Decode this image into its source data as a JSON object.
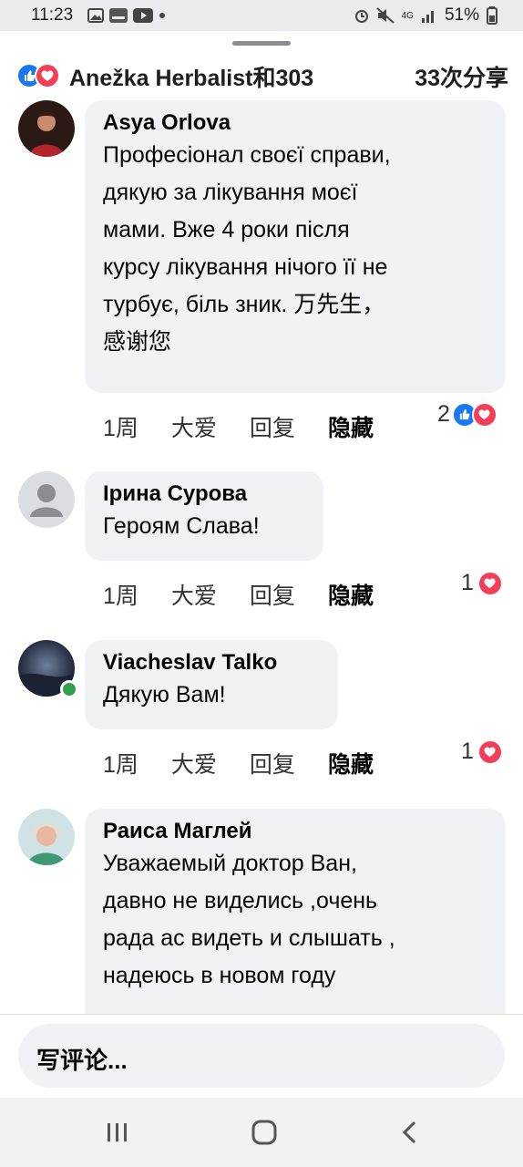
{
  "status_bar": {
    "time": "11:23",
    "signal_label": "4G",
    "battery": "51%"
  },
  "header": {
    "reactors": "Anežka Herbalist和303",
    "shares": "33次分享"
  },
  "comments": [
    {
      "author": "Asya Orlova",
      "lines": [
        "Професіонал своєї справи,",
        "дякую за лікування моєї",
        "мами. Вже 4 роки після",
        "курсу лікування нічого її не",
        "турбує, біль зник. 万先生，",
        "感谢您"
      ],
      "time": "1周",
      "love": "大爱",
      "reply": "回复",
      "hide": "隐藏",
      "reaction_count": "2",
      "reactions": [
        "like",
        "love"
      ]
    },
    {
      "author": "Ірина Сурова",
      "lines": [
        "Героям Слава!"
      ],
      "time": "1周",
      "love": "大爱",
      "reply": "回复",
      "hide": "隐藏",
      "reaction_count": "1",
      "reactions": [
        "love"
      ]
    },
    {
      "author": "Viacheslav Talko",
      "lines": [
        "Дякую Вам!"
      ],
      "time": "1周",
      "love": "大爱",
      "reply": "回复",
      "hide": "隐藏",
      "reaction_count": "1",
      "reactions": [
        "love"
      ]
    },
    {
      "author": "Раиса Маглей",
      "lines": [
        "Уважаемый  доктор  Ван,",
        "давно не виделись ,очень",
        "рада ас видеть и слышать ,",
        "надеюсь в новом году"
      ]
    }
  ],
  "composer": {
    "placeholder": "写评论..."
  },
  "colors": {
    "like_blue": "#1877f2",
    "love_red": "#f33e58",
    "bubble_gray": "#f0f2f5",
    "online_green": "#31a24c"
  }
}
